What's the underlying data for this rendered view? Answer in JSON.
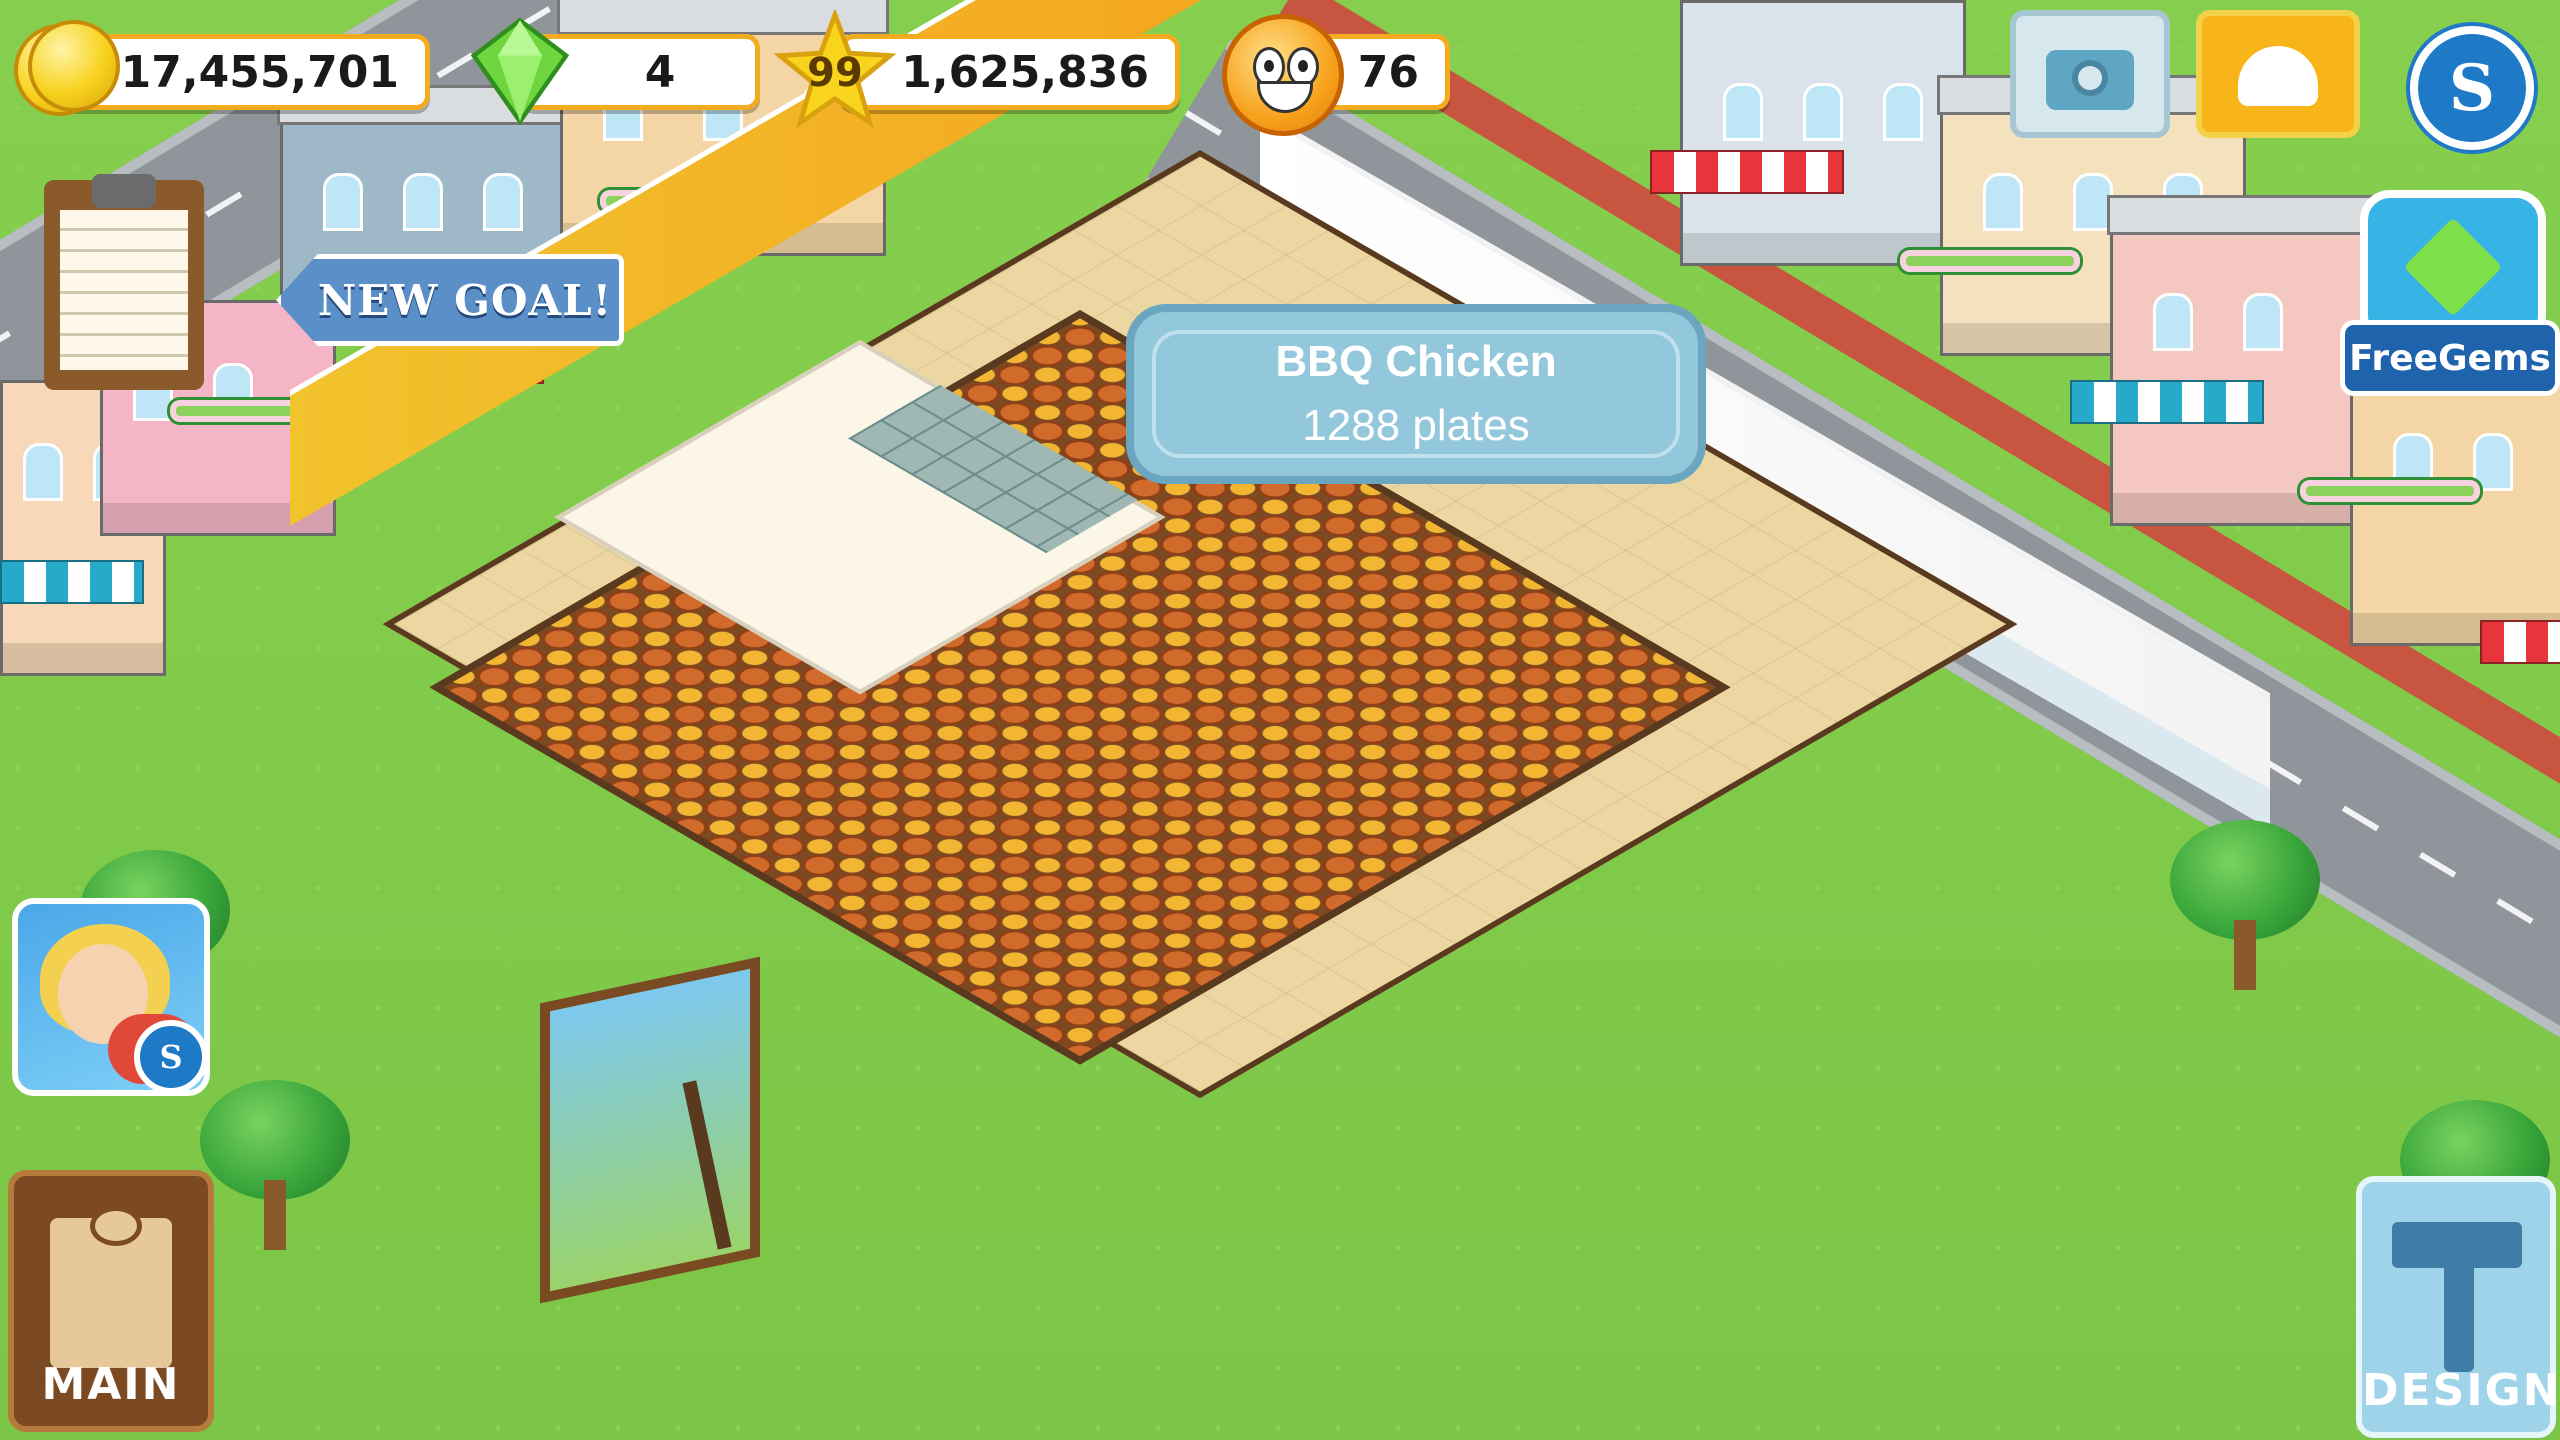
{
  "hud": {
    "coins": "17,455,701",
    "gems": "4",
    "level": "99",
    "xp": "1,625,836",
    "happiness": "76"
  },
  "goal": {
    "banner_label": "NEW GOAL!"
  },
  "tooltip": {
    "dish_name": "BBQ Chicken",
    "quantity": "1288 plates"
  },
  "free_gems": {
    "label": "FreeGems"
  },
  "buttons": {
    "main_label": "MAIN",
    "design_label": "DESIGN",
    "social_label": "S",
    "promo_badge": "S"
  },
  "icons": {
    "coins": "coin-stack-icon",
    "gems": "green-gem-icon",
    "xp": "star-icon",
    "happiness": "smiley-face-icon",
    "camera": "camera-icon",
    "phone": "phone-icon",
    "social": "social-s-icon",
    "goal": "clipboard-icon",
    "free_gems": "tv-gem-icon",
    "main": "clipboard-icon",
    "design": "hammer-icon"
  },
  "colors": {
    "grass": "#7fc94a",
    "pill_border": "#f3ab1f",
    "tooltip_bg": "#93c7db",
    "new_goal_bg": "#5b8fc8",
    "social_blue": "#1e79c7",
    "phone_orange": "#f7b51a"
  }
}
